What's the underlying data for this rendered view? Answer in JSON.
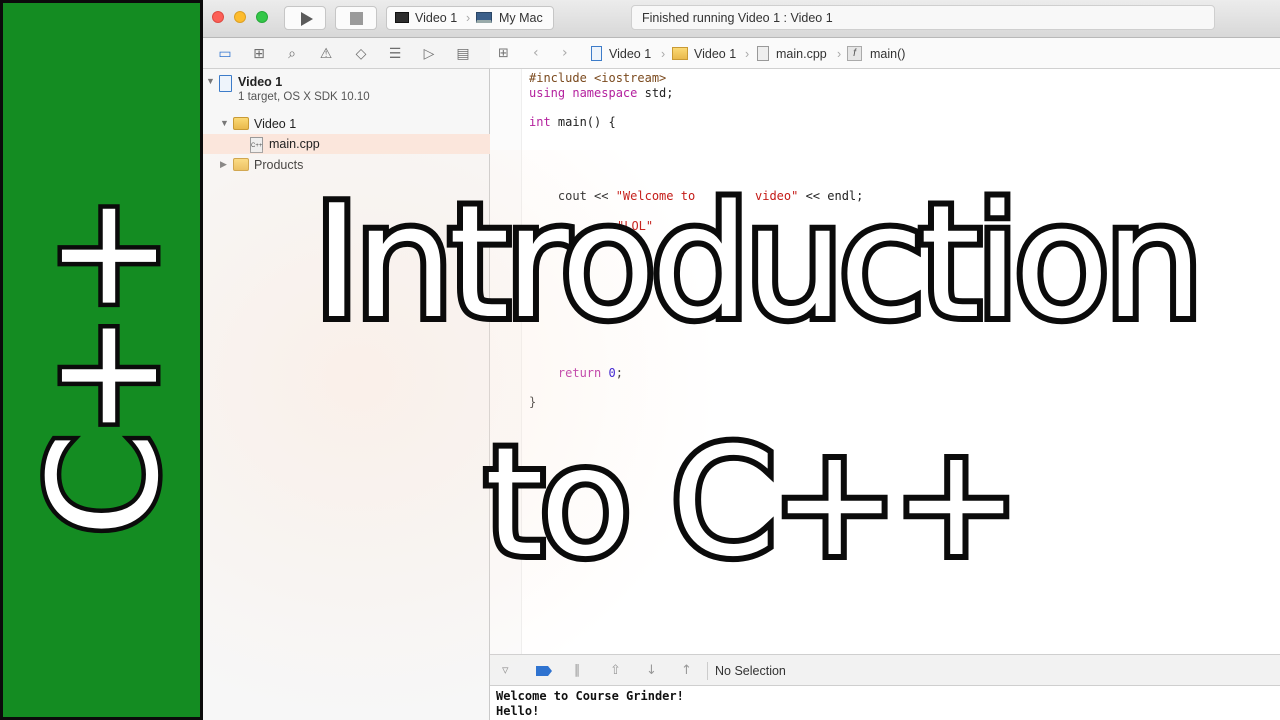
{
  "toolbar": {
    "scheme_target": "Video 1",
    "scheme_destination": "My Mac",
    "activity_status": "Finished running Video 1 : Video 1"
  },
  "navigator": {
    "project": {
      "name": "Video 1",
      "subtitle": "1 target, OS X SDK 10.10"
    },
    "group": "Video 1",
    "file": "main.cpp",
    "products": "Products"
  },
  "jumpbar": {
    "project": "Video 1",
    "group": "Video 1",
    "file": "main.cpp",
    "symbol": "main()"
  },
  "code_lines": [
    "#include <iostream>",
    "using namespace std;",
    "int main() {",
    "    cout << \"Welcome to",
    "video\" << endl;",
    "\"LOL\"",
    "    return 0;",
    "}"
  ],
  "debug": {
    "selection": "No Selection"
  },
  "console": [
    "Welcome to Course Grinder!",
    "Hello!"
  ],
  "thumbnail": {
    "side_label": "C++",
    "headline_line1": "Introduction",
    "headline_line2": "to C++"
  },
  "colors": {
    "brand_green": "#148c22",
    "keyword": "#b4219e",
    "string": "#c41a16",
    "number": "#1c00cf"
  }
}
